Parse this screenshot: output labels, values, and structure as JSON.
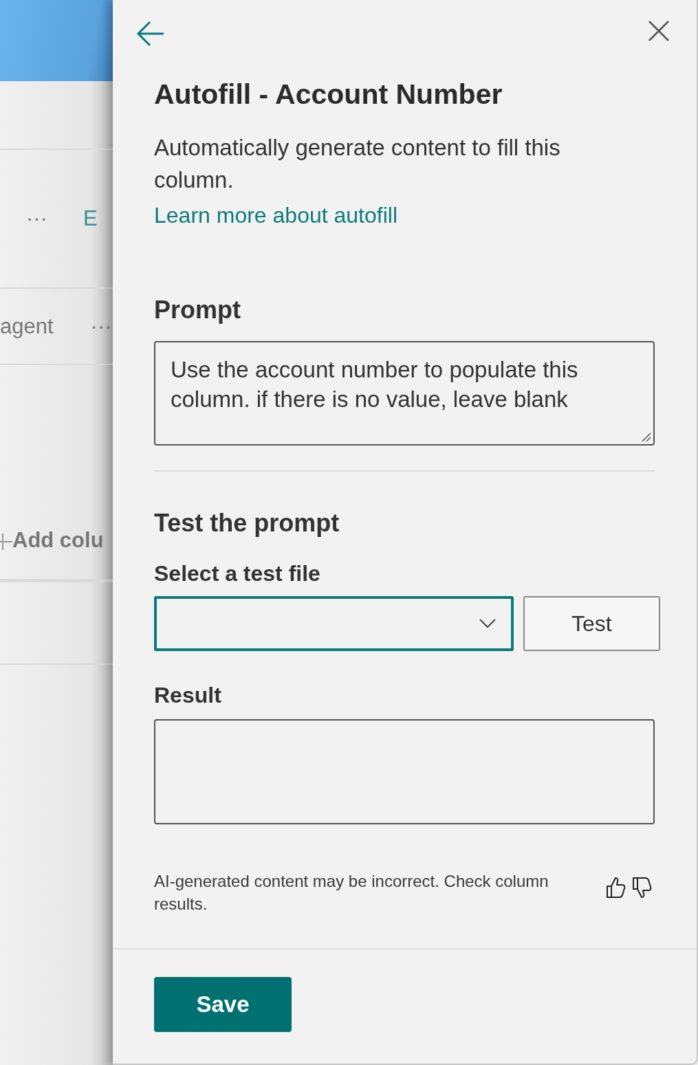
{
  "background": {
    "row_items": [
      {
        "kind": "more",
        "text": "···"
      },
      {
        "kind": "link",
        "text": "E"
      },
      {
        "kind": "label",
        "text": "agent"
      },
      {
        "kind": "more",
        "text": "···"
      },
      {
        "kind": "add",
        "text": "Add colu"
      }
    ]
  },
  "panel": {
    "title": "Autofill - Account Number",
    "description": "Automatically generate content to fill this column.",
    "link": "Learn more about autofill",
    "prompt": {
      "heading": "Prompt",
      "value": "Use the account number to populate this column. if there is no value, leave blank"
    },
    "test": {
      "heading": "Test the prompt",
      "file_label": "Select a test file",
      "dropdown_focused": true,
      "button": "Test"
    },
    "result": {
      "heading": "Result"
    },
    "disclaimer": "AI-generated content may be incorrect. Check column results.",
    "save_button": "Save"
  }
}
